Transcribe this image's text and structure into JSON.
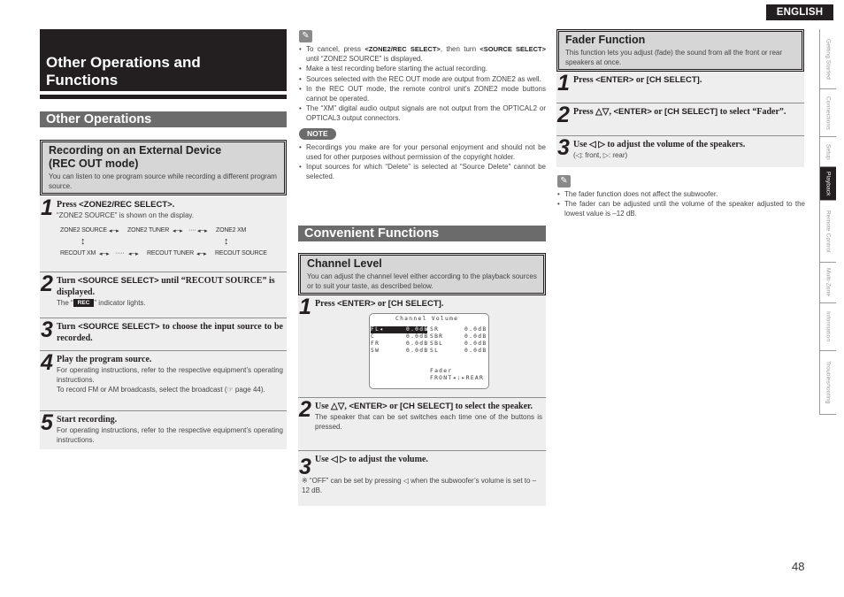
{
  "language_tab": "ENGLISH",
  "side_nav": [
    {
      "label": "Getting Started",
      "active": false
    },
    {
      "label": "Connections",
      "active": false
    },
    {
      "label": "Setup",
      "active": false
    },
    {
      "label": "Playback",
      "active": true
    },
    {
      "label": "Remote Control",
      "active": false
    },
    {
      "label": "Multi-Zone",
      "active": false
    },
    {
      "label": "Information",
      "active": false
    },
    {
      "label": "Troubleshooting",
      "active": false
    }
  ],
  "main_title_line1": "Other Operations and",
  "main_title_line2": "Functions",
  "other_operations": {
    "heading": "Other Operations",
    "rec_box": {
      "title_line1": "Recording on an External Device",
      "title_line2": "(REC OUT mode)",
      "desc": "You can listen to one program source while recording a different program source."
    },
    "steps": [
      {
        "num": "1",
        "pre": "Press ",
        "key": "<ZONE2/REC SELECT>",
        "post": ".",
        "body": "“ZONE2 SOURCE” is shown on the display."
      },
      {
        "num": "2",
        "pre": "Turn ",
        "key": "<SOURCE SELECT>",
        "post": " until “RECOUT SOURCE” is displayed.",
        "body_pre": "The “",
        "badge": "REC",
        "body_post": "” indicator lights."
      },
      {
        "num": "3",
        "pre": "Turn ",
        "key": "<SOURCE SELECT>",
        "post": " to choose the input source to be recorded."
      },
      {
        "num": "4",
        "head": "Play the program source.",
        "body1": "For operating instructions, refer to the respective equipment’s operating instructions.",
        "body2": "To record FM or AM broadcasts, select the broadcast (☞ page 44)."
      },
      {
        "num": "5",
        "head": "Start recording.",
        "body": "For operating instructions, refer to the respective equipment’s operating instructions."
      }
    ],
    "flow": {
      "top": [
        "ZONE2 SOURCE",
        "ZONE2 TUNER",
        "ZONE2 XM"
      ],
      "bottom": [
        "RECOUT XM",
        "RECOUT TUNER",
        "RECOUT SOURCE"
      ],
      "arrow": "◂─▸",
      "ellipsis": "····",
      "ellipsis_long": "·····",
      "vertical_arrow": "↕"
    }
  },
  "memo_icon": "✎",
  "memo_notes": [
    {
      "pre": "To cancel, press ",
      "k1": "<ZONE2/REC SELECT>",
      "mid": ", then turn ",
      "k2": "<SOURCE SELECT>",
      "post": " until “ZONE2 SOURCE” is displayed."
    },
    {
      "text": "Make a test recording before starting the actual recording."
    },
    {
      "text": "Sources selected with the REC OUT mode are output from ZONE2 as well."
    },
    {
      "text": "In the REC OUT mode, the remote control unit’s ZONE2 mode buttons cannot be operated."
    },
    {
      "text": "The “XM” digital audio output signals are not output from the OPTICAL2 or OPTICAL3 output connectors."
    }
  ],
  "note_badge": "NOTE",
  "note_items": [
    "Recordings you make are for your personal enjoyment and should not be used for other purposes without permission of the copyright holder.",
    "Input sources for which “Delete” is selected at “Source Delete” cannot be selected."
  ],
  "convenient": {
    "heading": "Convenient Functions",
    "channel_box": {
      "title": "Channel Level",
      "desc": "You can adjust the channel level either according to the playback sources or to suit your taste, as described below."
    },
    "steps": [
      {
        "num": "1",
        "pre": "Press ",
        "key": "<ENTER>",
        "mid": " or ",
        "key2": "[CH SELECT]",
        "post": "."
      },
      {
        "num": "2",
        "pre": "Use △▽, ",
        "key": "<ENTER>",
        "mid": " or ",
        "key2": "[CH SELECT]",
        "post": " to select the speaker.",
        "body": "The speaker that can be set switches each time one of the buttons is pressed."
      },
      {
        "num": "3",
        "head": "Use ◁ ▷ to adjust the volume.",
        "ref": "※ “OFF” can be set by pressing ◁ when the subwoofer’s volume is set to –12 dB."
      }
    ],
    "osd": {
      "title": "Channel Volume",
      "left": [
        {
          "ch": "FL",
          "val": "0.0dB",
          "selected": true
        },
        {
          "ch": "C",
          "val": "0.0dB"
        },
        {
          "ch": "FR",
          "val": "0.0dB"
        },
        {
          "ch": "SW",
          "val": "0.0dB"
        }
      ],
      "right": [
        {
          "ch": "SR",
          "val": "0.0dB"
        },
        {
          "ch": "SBR",
          "val": "0.0dB"
        },
        {
          "ch": "SBL",
          "val": "0.0dB"
        },
        {
          "ch": "SL",
          "val": "0.0dB"
        }
      ],
      "fader_label": "Fader",
      "fader_value": "FRONT◂:▸REAR"
    }
  },
  "fader": {
    "box": {
      "title": "Fader Function",
      "desc": "This function lets you adjust (fade) the sound from all the front or rear speakers at once."
    },
    "steps": [
      {
        "num": "1",
        "pre": "Press ",
        "key": "<ENTER>",
        "mid": " or ",
        "key2": "[CH SELECT]",
        "post": "."
      },
      {
        "num": "2",
        "pre": "Press △▽, ",
        "key": "<ENTER>",
        "mid": " or ",
        "key2": "[CH SELECT]",
        "post": " to select “Fader”."
      },
      {
        "num": "3",
        "head": "Use ◁ ▷ to adjust the volume of the speakers.",
        "body": "(◁: front, ▷: rear)"
      }
    ],
    "notes": [
      "The fader function does not affect the subwoofer.",
      "The fader can be adjusted until the volume of the speaker adjusted to the lowest value is –12 dB."
    ]
  },
  "page_number": "48"
}
